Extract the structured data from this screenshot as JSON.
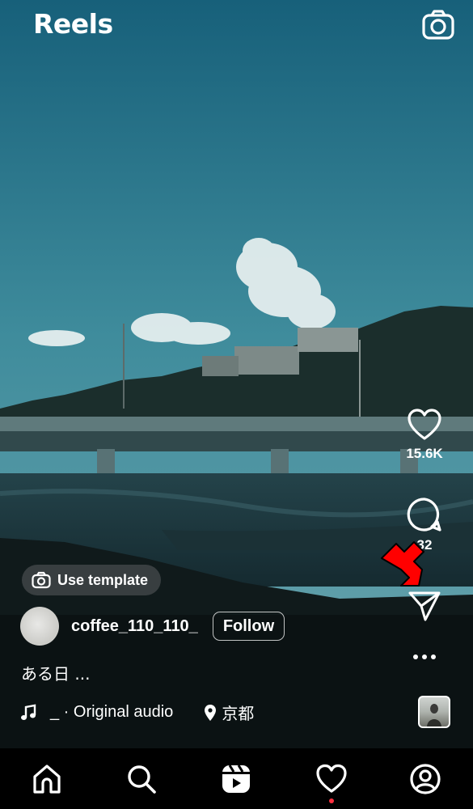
{
  "header": {
    "title": "Reels",
    "camera_icon": "camera-icon"
  },
  "actions": {
    "like_count": "15.6K",
    "comment_count": "32",
    "icons": [
      "heart-icon",
      "comment-icon",
      "share-icon",
      "more-icon"
    ]
  },
  "template": {
    "label": "Use template"
  },
  "post": {
    "username": "coffee_110_110_",
    "follow_label": "Follow",
    "caption": "ある日 ...",
    "audio": "_ · Original audio",
    "location": "京都"
  },
  "bottom_nav": {
    "items": [
      "home-icon",
      "search-icon",
      "reels-icon",
      "activity-icon",
      "profile-icon"
    ],
    "notification_color": "#ff3040"
  },
  "colors": {
    "accent_arrow": "#ff0000"
  }
}
